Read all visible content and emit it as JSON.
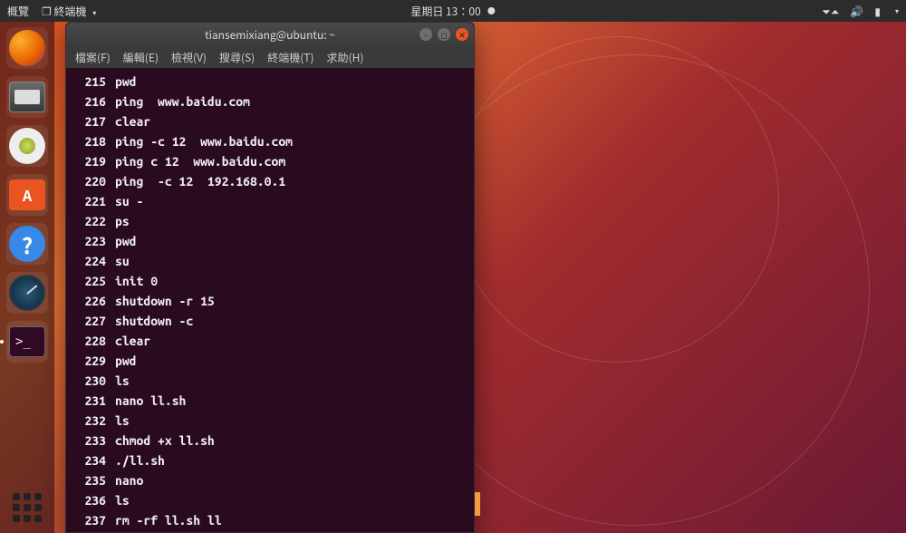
{
  "top_panel": {
    "activities": "概覽",
    "app_menu": "終端機",
    "clock": "星期日 13：00",
    "tray": {
      "network": "⯎",
      "volume": "🔊",
      "battery": "🔋"
    }
  },
  "dock": {
    "firefox": "Firefox",
    "files": "Files",
    "music": "Rhythmbox",
    "store": "A",
    "help": "?",
    "clock": "Clocks",
    "terminal": ">_",
    "apps": "Show Applications"
  },
  "terminal": {
    "title": "tiansemixiang@ubuntu: ~",
    "menu": {
      "file": "檔案(F)",
      "edit": "編輯(E)",
      "view": "檢視(V)",
      "search": "搜尋(S)",
      "terminal": "終端機(T)",
      "help": "求助(H)"
    },
    "history": [
      {
        "n": "215",
        "c": "pwd"
      },
      {
        "n": "216",
        "c": "ping  www.baidu.com"
      },
      {
        "n": "217",
        "c": "clear"
      },
      {
        "n": "218",
        "c": "ping -c 12  www.baidu.com"
      },
      {
        "n": "219",
        "c": "ping c 12  www.baidu.com"
      },
      {
        "n": "220",
        "c": "ping  -c 12  192.168.0.1"
      },
      {
        "n": "221",
        "c": "su -"
      },
      {
        "n": "222",
        "c": "ps"
      },
      {
        "n": "223",
        "c": "pwd"
      },
      {
        "n": "224",
        "c": "su"
      },
      {
        "n": "225",
        "c": "init 0"
      },
      {
        "n": "226",
        "c": "shutdown -r 15"
      },
      {
        "n": "227",
        "c": "shutdown -c"
      },
      {
        "n": "228",
        "c": "clear"
      },
      {
        "n": "229",
        "c": "pwd"
      },
      {
        "n": "230",
        "c": "ls"
      },
      {
        "n": "231",
        "c": "nano ll.sh"
      },
      {
        "n": "232",
        "c": "ls"
      },
      {
        "n": "233",
        "c": "chmod +x ll.sh"
      },
      {
        "n": "234",
        "c": "./ll.sh"
      },
      {
        "n": "235",
        "c": "nano"
      },
      {
        "n": "236",
        "c": "ls"
      },
      {
        "n": "237",
        "c": "rm -rf ll.sh ll"
      }
    ]
  }
}
